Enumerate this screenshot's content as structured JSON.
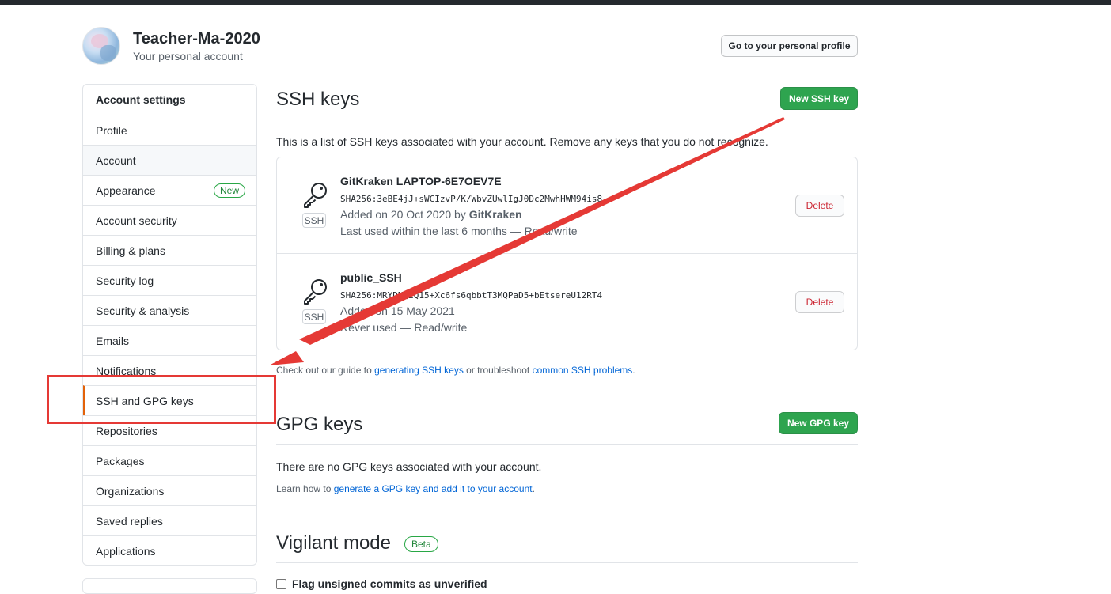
{
  "header": {
    "username": "Teacher-Ma-2020",
    "subtitle": "Your personal account",
    "profile_button": "Go to your personal profile"
  },
  "sidebar": {
    "title": "Account settings",
    "items": [
      {
        "label": "Profile"
      },
      {
        "label": "Account"
      },
      {
        "label": "Appearance",
        "badge": "New"
      },
      {
        "label": "Account security"
      },
      {
        "label": "Billing & plans"
      },
      {
        "label": "Security log"
      },
      {
        "label": "Security & analysis"
      },
      {
        "label": "Emails"
      },
      {
        "label": "Notifications"
      },
      {
        "label": "SSH and GPG keys"
      },
      {
        "label": "Repositories"
      },
      {
        "label": "Packages"
      },
      {
        "label": "Organizations"
      },
      {
        "label": "Saved replies"
      },
      {
        "label": "Applications"
      }
    ],
    "selected_item": "SSH and GPG keys"
  },
  "ssh": {
    "title": "SSH keys",
    "new_button": "New SSH key",
    "description": "This is a list of SSH keys associated with your account. Remove any keys that you do not recognize.",
    "keys": [
      {
        "title": "GitKraken LAPTOP-6E7OEV7E",
        "fingerprint": "SHA256:3eBE4jJ+sWCIzvP/K/WbvZUwlIgJ0Dc2MwhHWM94is8",
        "added_prefix": "Added on 20 Oct 2020 by",
        "added_by": "GitKraken",
        "usage": "Last used within the last 6 months — Read/write",
        "type_label": "SSH",
        "delete_label": "Delete"
      },
      {
        "title": "public_SSH",
        "fingerprint": "SHA256:MRYDNQ2Q15+Xc6fs6qbbtT3MQPaD5+bEtsereU12RT4",
        "added_prefix": "Added on 15 May 2021",
        "added_by": "",
        "usage": "Never used — Read/write",
        "type_label": "SSH",
        "delete_label": "Delete"
      }
    ],
    "guide_prefix": "Check out our guide to",
    "guide_link1": "generating SSH keys",
    "guide_middle": "or troubleshoot",
    "guide_link2": "common SSH problems",
    "guide_suffix": "."
  },
  "gpg": {
    "title": "GPG keys",
    "new_button": "New GPG key",
    "empty_text": "There are no GPG keys associated with your account.",
    "learn_prefix": "Learn how to",
    "learn_link": "generate a GPG key and add it to your account",
    "learn_suffix": "."
  },
  "vigilant": {
    "title": "Vigilant mode",
    "badge": "Beta",
    "checkbox_label": "Flag unsigned commits as unverified"
  },
  "colors": {
    "primary_green": "#2ea44f",
    "link_blue": "#0366d6",
    "danger_red": "#cb2431",
    "annotation_red": "#e53935",
    "selected_marker": "#e36209"
  },
  "icons": {
    "key": "key-icon",
    "checkbox": "checkbox-icon"
  }
}
